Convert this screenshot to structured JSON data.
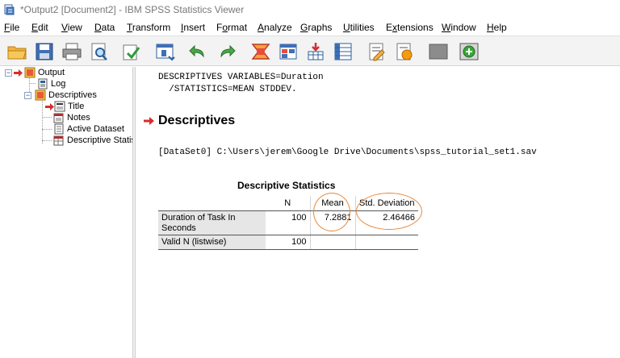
{
  "window": {
    "title": "*Output2 [Document2] - IBM SPSS Statistics Viewer"
  },
  "menu": {
    "items": [
      {
        "label": "File",
        "key": "F"
      },
      {
        "label": "Edit",
        "key": "E"
      },
      {
        "label": "View",
        "key": "V"
      },
      {
        "label": "Data",
        "key": "D"
      },
      {
        "label": "Transform",
        "key": "T"
      },
      {
        "label": "Insert",
        "key": "I"
      },
      {
        "label": "Format",
        "key": "o"
      },
      {
        "label": "Analyze",
        "key": "A"
      },
      {
        "label": "Graphs",
        "key": "G"
      },
      {
        "label": "Utilities",
        "key": "U"
      },
      {
        "label": "Extensions",
        "key": "x"
      },
      {
        "label": "Window",
        "key": "W"
      },
      {
        "label": "Help",
        "key": "H"
      }
    ]
  },
  "toolbar": {
    "icons": [
      "open-folder-icon",
      "save-icon",
      "print-icon",
      "print-preview-icon",
      "export-icon",
      "recall-dialog-icon",
      "undo-icon",
      "redo-icon",
      "goto-data-icon",
      "goto-case-icon",
      "insert-variable-icon",
      "variables-icon",
      "insert-heading-icon",
      "insert-text-icon",
      "designate-window-icon",
      "add-output-icon"
    ]
  },
  "tree": {
    "output": "Output",
    "log": "Log",
    "descriptives": "Descriptives",
    "title": "Title",
    "notes": "Notes",
    "active_dataset": "Active Dataset",
    "descriptive_statistics": "Descriptive Statis"
  },
  "output": {
    "syntax_line1": "DESCRIPTIVES VARIABLES=Duration",
    "syntax_line2": "  /STATISTICS=MEAN STDDEV.",
    "heading": "Descriptives",
    "dataset": "[DataSet0] C:\\Users\\jerem\\Google Drive\\Documents\\spss_tutorial_set1.sav"
  },
  "table": {
    "title": "Descriptive Statistics",
    "headers": {
      "n": "N",
      "mean": "Mean",
      "std": "Std. Deviation"
    },
    "rows": [
      {
        "label_line1": "Duration of Task In",
        "label_line2": "Seconds",
        "n": "100",
        "mean": "7.2881",
        "std": "2.46466"
      },
      {
        "label_line1": "Valid N (listwise)",
        "label_line2": "",
        "n": "100",
        "mean": "",
        "std": ""
      }
    ]
  },
  "colors": {
    "annotation": "#e8893a",
    "heading_arrow": "#d92b2b"
  }
}
